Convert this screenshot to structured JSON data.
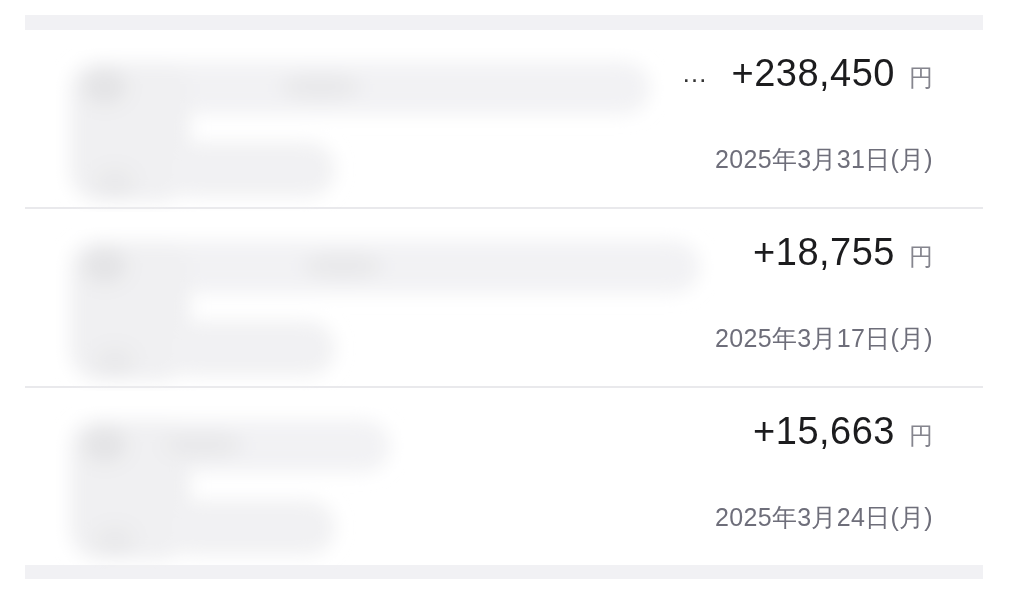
{
  "transactions": [
    {
      "title_end": "…",
      "amount": "+238,450",
      "currency": "円",
      "date": "2025年3月31日(月)"
    },
    {
      "amount": "+18,755",
      "currency": "円",
      "date": "2025年3月17日(月)"
    },
    {
      "amount": "+15,663",
      "currency": "円",
      "date": "2025年3月24日(月)"
    }
  ]
}
